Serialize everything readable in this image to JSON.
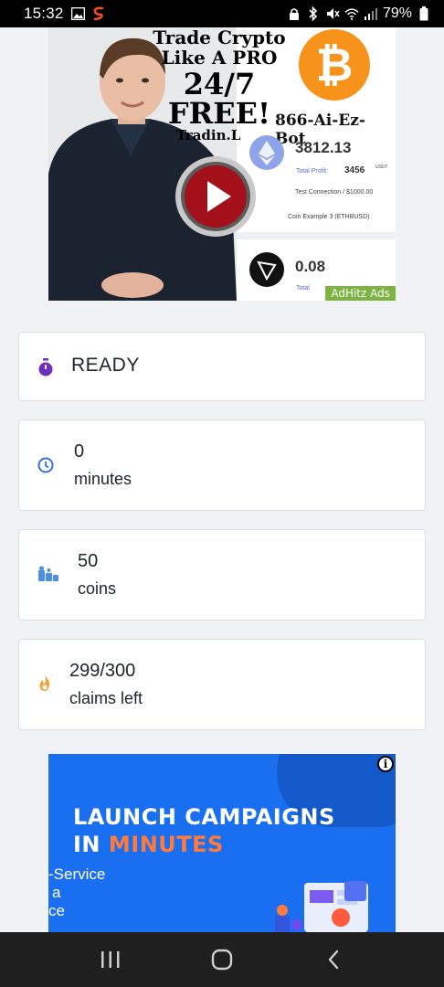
{
  "status_bar": {
    "time": "15:32",
    "battery": "79%"
  },
  "ad_top": {
    "headline_1": "Trade Crypto",
    "headline_2": "Like A PRO",
    "headline_3": "24/7",
    "headline_4": "FREE!",
    "site": "Tradin.Live",
    "phone": "866-Ai-Ez-Bot",
    "value_1": "3812.13",
    "total_profit_label": "Total Profit:",
    "total_profit_value": "3456",
    "currency": "USDT",
    "test_connection": "Test Connection / $1000.00",
    "coin_example": "Coin Example 3 (ETHBUSD)",
    "value_2": "0.08",
    "total_label": "Total",
    "badge": "AdHitz Ads"
  },
  "cards": {
    "status": {
      "value": "READY",
      "icon": "stopwatch-icon",
      "color": "#6f2dbd"
    },
    "timer": {
      "value": "0",
      "label": "minutes",
      "icon": "clock-icon",
      "color": "#3b6fd9"
    },
    "coins": {
      "value": "50",
      "label": "coins",
      "icon": "coins-icon",
      "color": "#4a8fe0"
    },
    "claims": {
      "value": "299/300",
      "label": "claims left",
      "icon": "flame-icon",
      "color": "#f0a640"
    }
  },
  "ad_bottom": {
    "title_line1": "LAUNCH CAMPAIGNS",
    "title_line2_prefix": "IN ",
    "title_line2_highlight": "MINUTES",
    "sub_line1": "-Service",
    "sub_line2": "a",
    "sub_line3": "ce",
    "info": "i"
  }
}
